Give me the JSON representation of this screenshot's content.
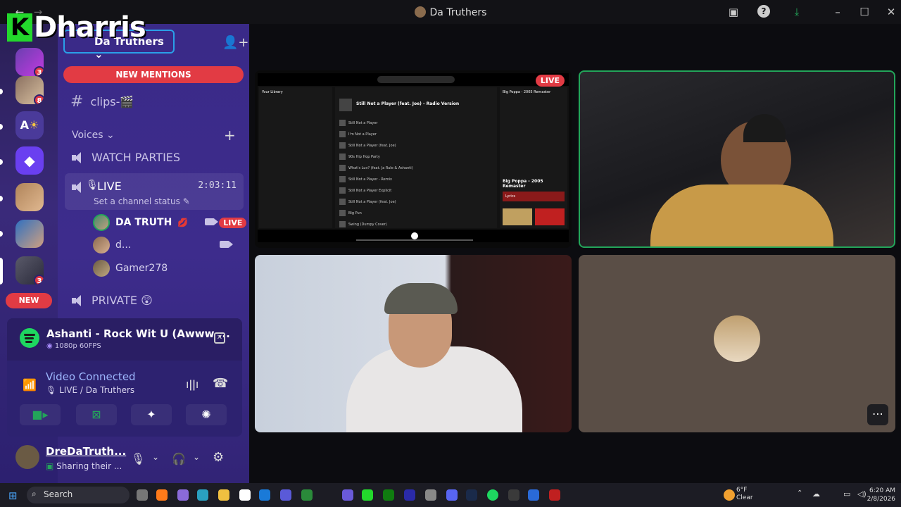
{
  "window": {
    "title": "Da Truthers"
  },
  "overlay": {
    "k_letter": "K",
    "name": "Dharris"
  },
  "servers": {
    "badges": [
      "3",
      "8",
      "3"
    ],
    "letter_icon": "A",
    "new_pill": "NEW"
  },
  "channel_panel": {
    "server_name": "Da Truthers",
    "new_mentions": "NEW MENTIONS",
    "text_channel": "clips-🎬",
    "voices_header": "Voices",
    "watch_parties": "WATCH PARTIES",
    "live_channel": {
      "name": "LIVE",
      "timer": "2:03:11",
      "status": "Set a channel status"
    },
    "users": [
      {
        "name": "DA TRUTH",
        "badge": "LIVE"
      },
      {
        "name": "d..."
      },
      {
        "name": "Gamer278"
      }
    ],
    "private_channel": "PRIVATE 😲"
  },
  "now_playing": {
    "title": "Ashanti - Rock Wit U (Awww ...",
    "quality": "1080p 60FPS"
  },
  "voice_connection": {
    "title": "Video Connected",
    "location": "LIVE / Da Truthers"
  },
  "account": {
    "name": "DreDaTruth...",
    "status": "Sharing their ..."
  },
  "stream": {
    "live_badge": "LIVE",
    "spotify_song": "Still Not a Player (feat. Joe) - Radio Version",
    "now_playing_side": "Big Poppa - 2005 Remaster",
    "lyrics": "Lyrics",
    "library": "Your Library",
    "tracks": [
      "Still Not a Player",
      "I'm Not a Player",
      "Still Not a Player (feat. Joe)",
      "90s Hip Hop Party",
      "What's Luv? (feat. Ja Rule & Ashanti)",
      "Still Not a Player - Remix",
      "Still Not a Player Explicit",
      "Still Not a Player (feat. Joe)",
      "Big Pun",
      "Swing (Dumpy Cover)"
    ]
  },
  "taskbar": {
    "search": "Search",
    "weather_temp": "6°F",
    "weather_desc": "Clear",
    "time": "6:20 AM",
    "date": "2/8/2026"
  }
}
